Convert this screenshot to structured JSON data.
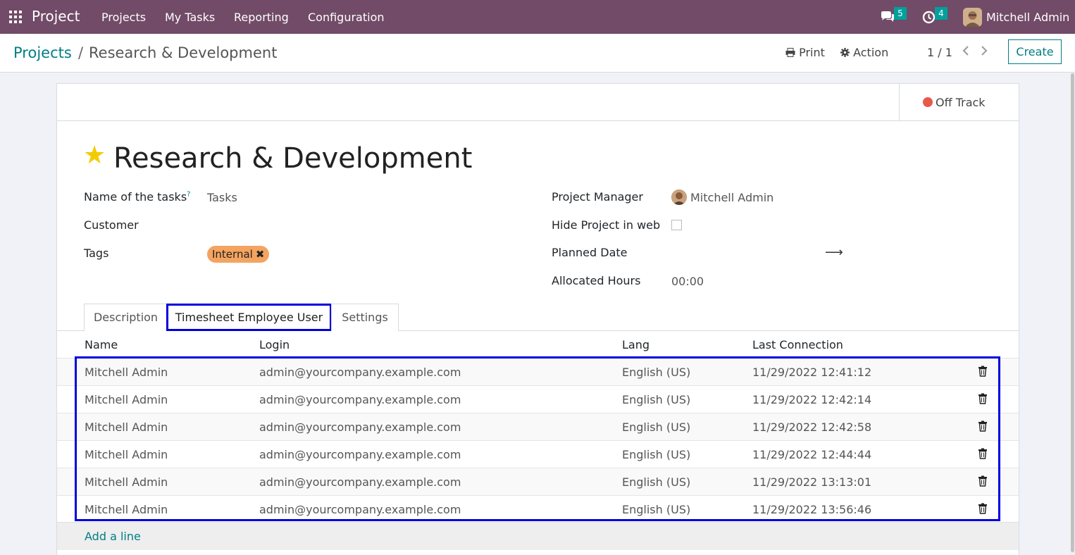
{
  "navbar": {
    "app_name": "Project",
    "menus": [
      "Projects",
      "My Tasks",
      "Reporting",
      "Configuration"
    ],
    "messages_count": "5",
    "activities_count": "4",
    "user_name": "Mitchell Admin",
    "color": "#714b67"
  },
  "control_panel": {
    "breadcrumb_parent": "Projects",
    "breadcrumb_separator": "/",
    "breadcrumb_current": "Research & Development",
    "print_label": "Print",
    "action_label": "Action",
    "pager": "1 / 1",
    "create_label": "Create"
  },
  "status": {
    "label": "Off Track",
    "color": "#e9594b"
  },
  "form": {
    "title": "Research & Development",
    "favorite": true,
    "name_of_tasks_label": "Name of the tasks",
    "name_of_tasks_help": "?",
    "name_of_tasks_value": "Tasks",
    "customer_label": "Customer",
    "tags_label": "Tags",
    "tags": [
      {
        "name": "Internal",
        "remove_glyph": "✖"
      }
    ],
    "project_manager_label": "Project Manager",
    "project_manager_value": "Mitchell Admin",
    "hide_web_label": "Hide Project in web",
    "planned_date_label": "Planned Date",
    "planned_date_arrow": "⟶",
    "allocated_hours_label": "Allocated Hours",
    "allocated_hours_value": "00:00"
  },
  "tabs": [
    {
      "label": "Description",
      "active": false
    },
    {
      "label": "Timesheet Employee User",
      "active": true
    },
    {
      "label": "Settings",
      "active": false
    }
  ],
  "table": {
    "columns": [
      "Name",
      "Login",
      "Lang",
      "Last Connection"
    ],
    "rows": [
      [
        "Mitchell Admin",
        "admin@yourcompany.example.com",
        "English (US)",
        "11/29/2022 12:41:12"
      ],
      [
        "Mitchell Admin",
        "admin@yourcompany.example.com",
        "English (US)",
        "11/29/2022 12:42:14"
      ],
      [
        "Mitchell Admin",
        "admin@yourcompany.example.com",
        "English (US)",
        "11/29/2022 12:42:58"
      ],
      [
        "Mitchell Admin",
        "admin@yourcompany.example.com",
        "English (US)",
        "11/29/2022 12:44:44"
      ],
      [
        "Mitchell Admin",
        "admin@yourcompany.example.com",
        "English (US)",
        "11/29/2022 13:13:01"
      ],
      [
        "Mitchell Admin",
        "admin@yourcompany.example.com",
        "English (US)",
        "11/29/2022 13:56:46"
      ]
    ],
    "add_line_label": "Add a line"
  },
  "icons": {
    "apps": "apps-grid-icon",
    "messages": "chat-icon",
    "activities": "clock-icon",
    "print": "printer-icon",
    "action": "gear-icon",
    "delete": "trash-icon"
  }
}
